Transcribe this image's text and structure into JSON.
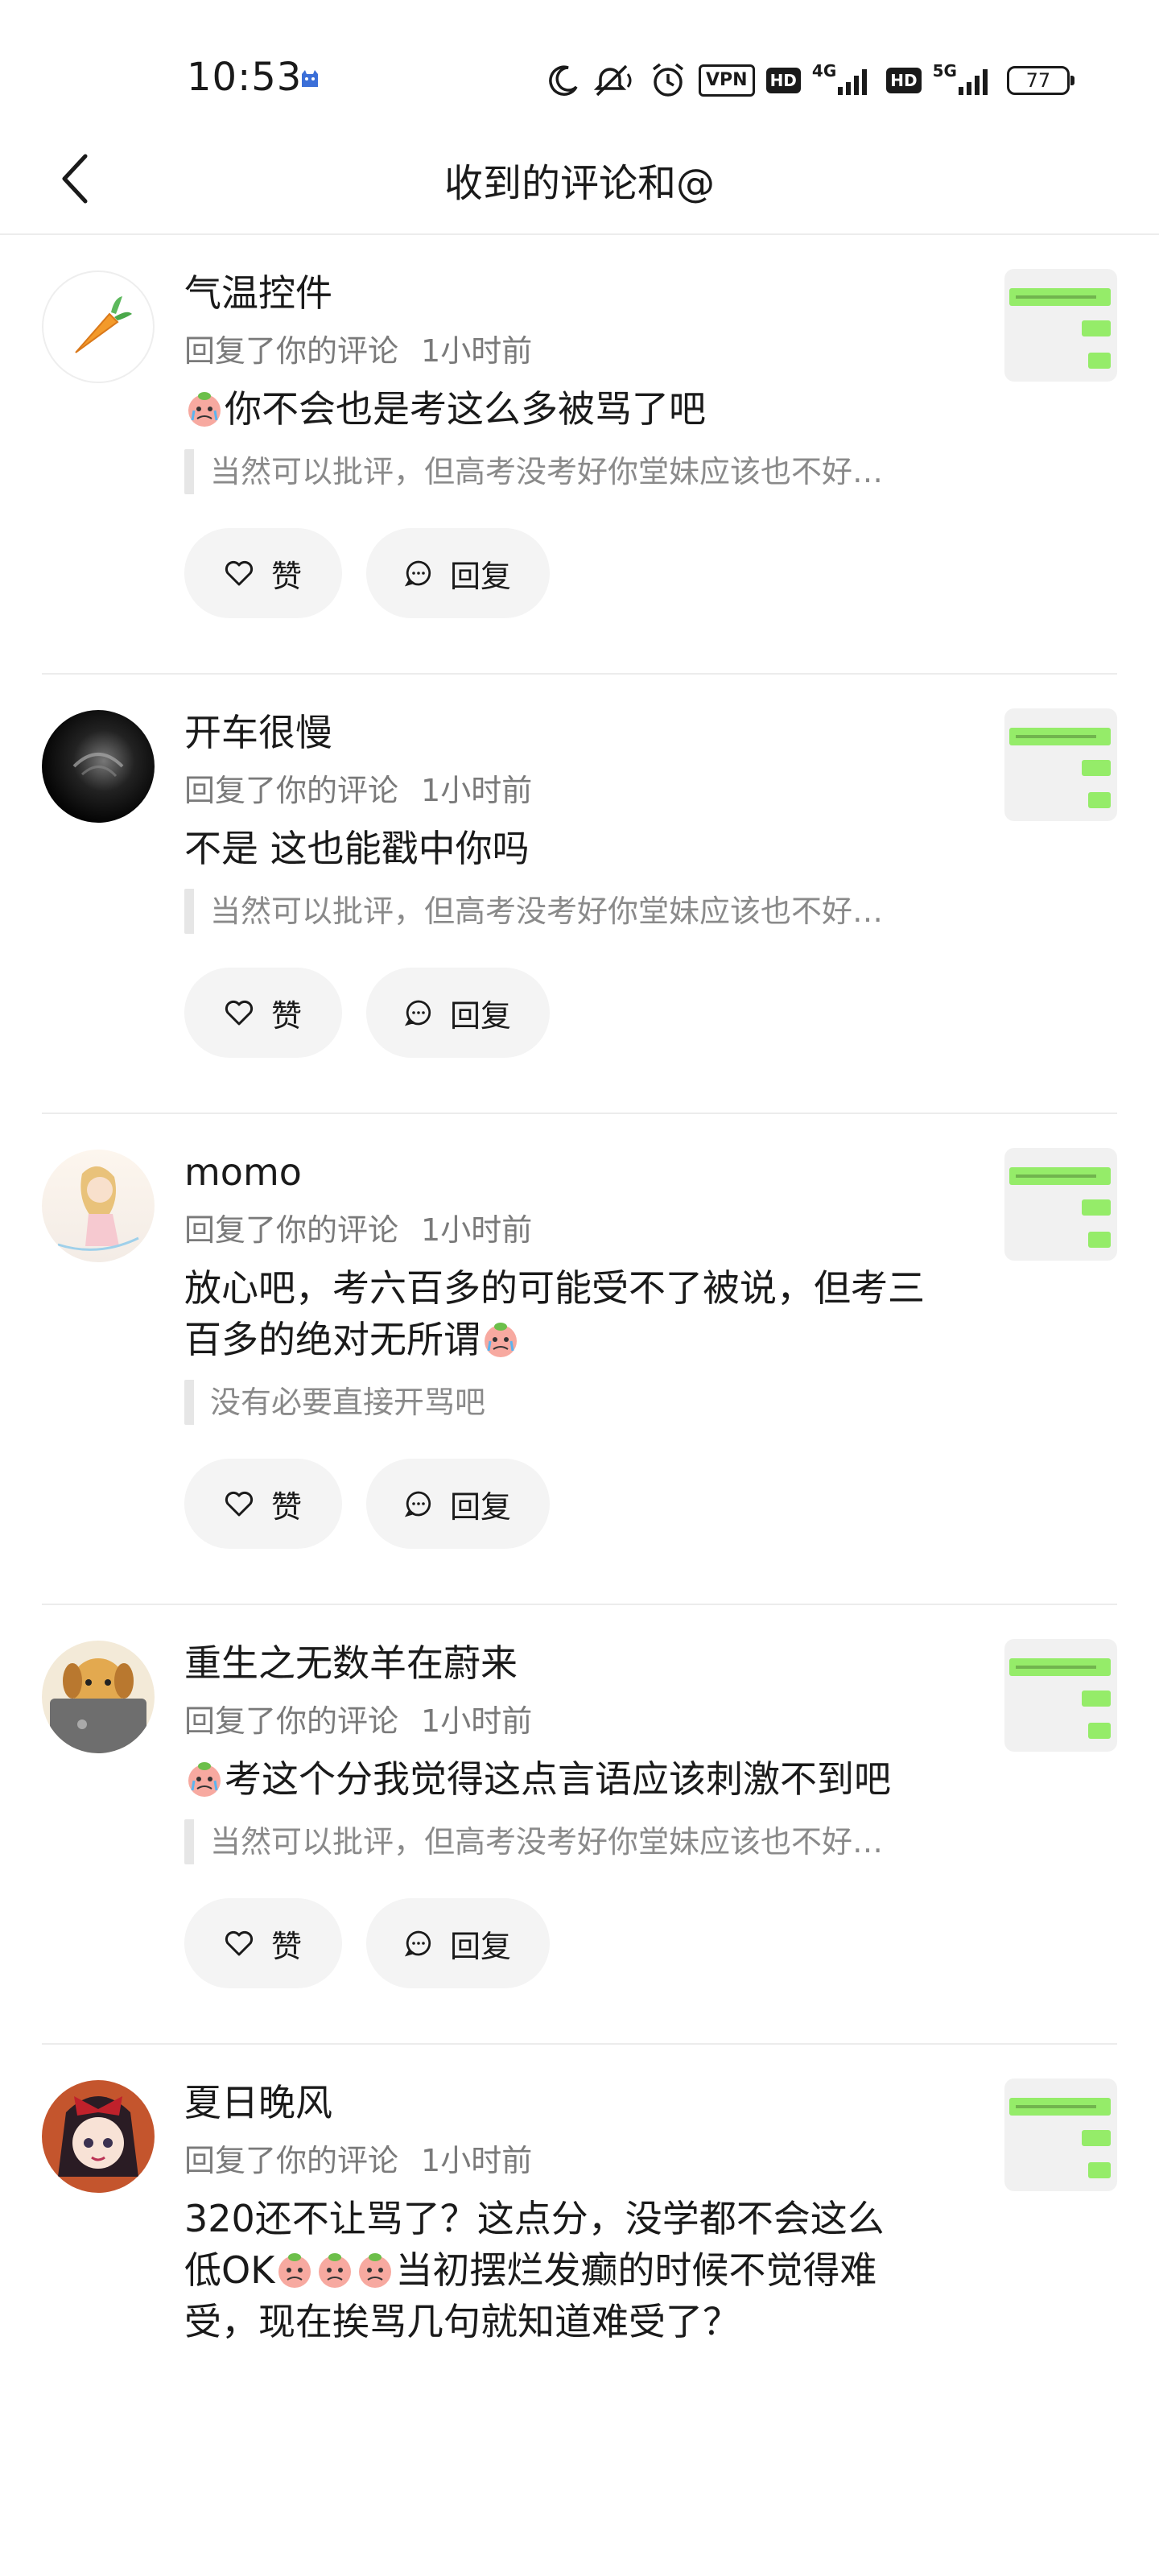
{
  "status_bar": {
    "time": "10:53",
    "vpn": "VPN",
    "hd1": "HD",
    "net1": "4G",
    "hd2": "HD",
    "net2": "5G",
    "battery": "77"
  },
  "header": {
    "title": "收到的评论和@"
  },
  "actions": {
    "like_label": "赞",
    "reply_label": "回复"
  },
  "comments": [
    {
      "name": "气温控件",
      "meta": "回复了你的评论",
      "time": "1小时前",
      "text": "你不会也是考这么多被骂了吧",
      "quote": "当然可以批评，但高考没考好你堂妹应该也不好…"
    },
    {
      "name": "开车很慢",
      "meta": "回复了你的评论",
      "time": "1小时前",
      "text": "不是 这也能戳中你吗",
      "quote": "当然可以批评，但高考没考好你堂妹应该也不好…"
    },
    {
      "name": "momo",
      "meta": "回复了你的评论",
      "time": "1小时前",
      "text": "放心吧，考六百多的可能受不了被说，但考三百多的绝对无所谓",
      "quote": "没有必要直接开骂吧"
    },
    {
      "name": "重生之无数羊在蔚来",
      "meta": "回复了你的评论",
      "time": "1小时前",
      "text": "考这个分我觉得这点言语应该刺激不到吧",
      "quote": "当然可以批评，但高考没考好你堂妹应该也不好…"
    },
    {
      "name": "夏日晚风",
      "meta": "回复了你的评论",
      "time": "1小时前",
      "text_a": "320还不让骂了？这点分，没学都不会这么低OK",
      "text_b": "当初摆烂发癫的时候不觉得难受，现在挨骂几句就知道难受了？"
    }
  ]
}
